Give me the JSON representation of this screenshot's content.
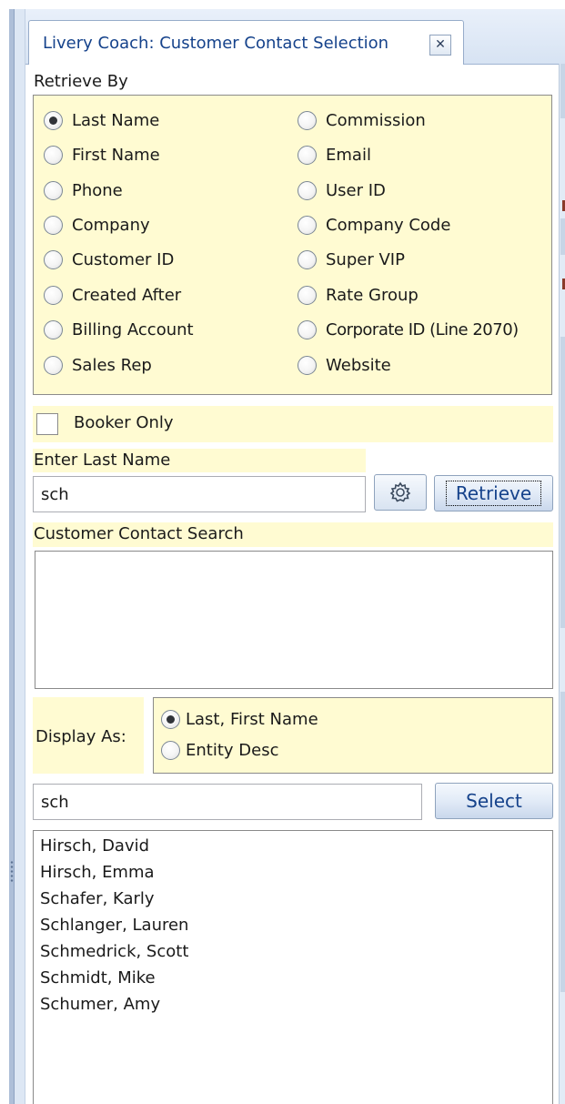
{
  "tab": {
    "title": "Livery Coach: Customer Contact Selection",
    "close_glyph": "✕"
  },
  "retrieve_by": {
    "label": "Retrieve By",
    "options": [
      "Last Name",
      "Commission",
      "First Name",
      "Email",
      "Phone",
      "User ID",
      "Company",
      "Company Code",
      "Customer ID",
      "Super VIP",
      "Created After",
      "Rate Group",
      "Billing Account",
      "Corporate ID (Line 2070)",
      "Sales Rep",
      "Website"
    ],
    "selected": "Last Name"
  },
  "booker_only": {
    "label": "Booker Only",
    "checked": false
  },
  "enter": {
    "label": "Enter Last Name",
    "value": "sch",
    "settings_icon": "gear-icon",
    "retrieve_label": "Retrieve"
  },
  "search": {
    "label": "Customer Contact Search"
  },
  "display_as": {
    "label": "Display As:",
    "options": [
      "Last, First Name",
      "Entity Desc"
    ],
    "selected": "Last, First Name"
  },
  "filter": {
    "value": "sch",
    "select_label": "Select"
  },
  "results": [
    "Hirsch, David",
    "Hirsch, Emma",
    "Schafer, Karly",
    "Schlanger, Lauren",
    "Schmedrick, Scott",
    "Schmidt, Mike",
    "Schumer, Amy"
  ],
  "colors": {
    "panel_yellow": "#fffbd2",
    "tab_text": "#15428b",
    "frame_blue": "#aebfd8"
  }
}
